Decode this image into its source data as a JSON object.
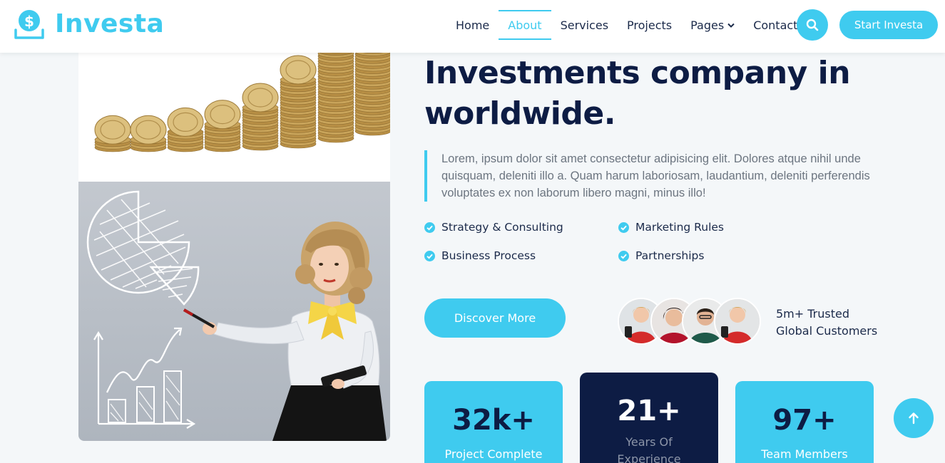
{
  "header": {
    "brand_name": "Investa",
    "brand_icon": "dollar-coin-icon",
    "nav": [
      {
        "label": "Home",
        "active": false
      },
      {
        "label": "About",
        "active": true
      },
      {
        "label": "Services",
        "active": false
      },
      {
        "label": "Projects",
        "active": false
      },
      {
        "label": "Pages",
        "active": false,
        "has_dropdown": true
      },
      {
        "label": "Contact",
        "active": false
      }
    ],
    "search_icon": "search-icon",
    "cta_label": "Start Investa"
  },
  "about": {
    "headline": "Investments company in worldwide.",
    "description": "Lorem, ipsum dolor sit amet consectetur adipisicing elit. Dolores atque nihil unde quisquam, deleniti illo a. Quam harum laboriosam, laudantium, deleniti perferendis voluptates ex non laborum libero magni, minus illo!",
    "features": [
      "Strategy & Consulting",
      "Marketing Rules",
      "Business Process",
      "Partnerships"
    ],
    "discover_label": "Discover More",
    "trusted_line1": "5m+ Trusted",
    "trusted_line2": "Global Customers"
  },
  "stats": [
    {
      "value": "32k+",
      "label": "Project Complete"
    },
    {
      "value": "21+",
      "label": "Years Of Experience"
    },
    {
      "value": "97+",
      "label": "Team Members"
    }
  ],
  "colors": {
    "accent": "#3fcbef",
    "navy": "#0d1c44",
    "text": "#6c7580",
    "background": "#f4f7f9"
  }
}
